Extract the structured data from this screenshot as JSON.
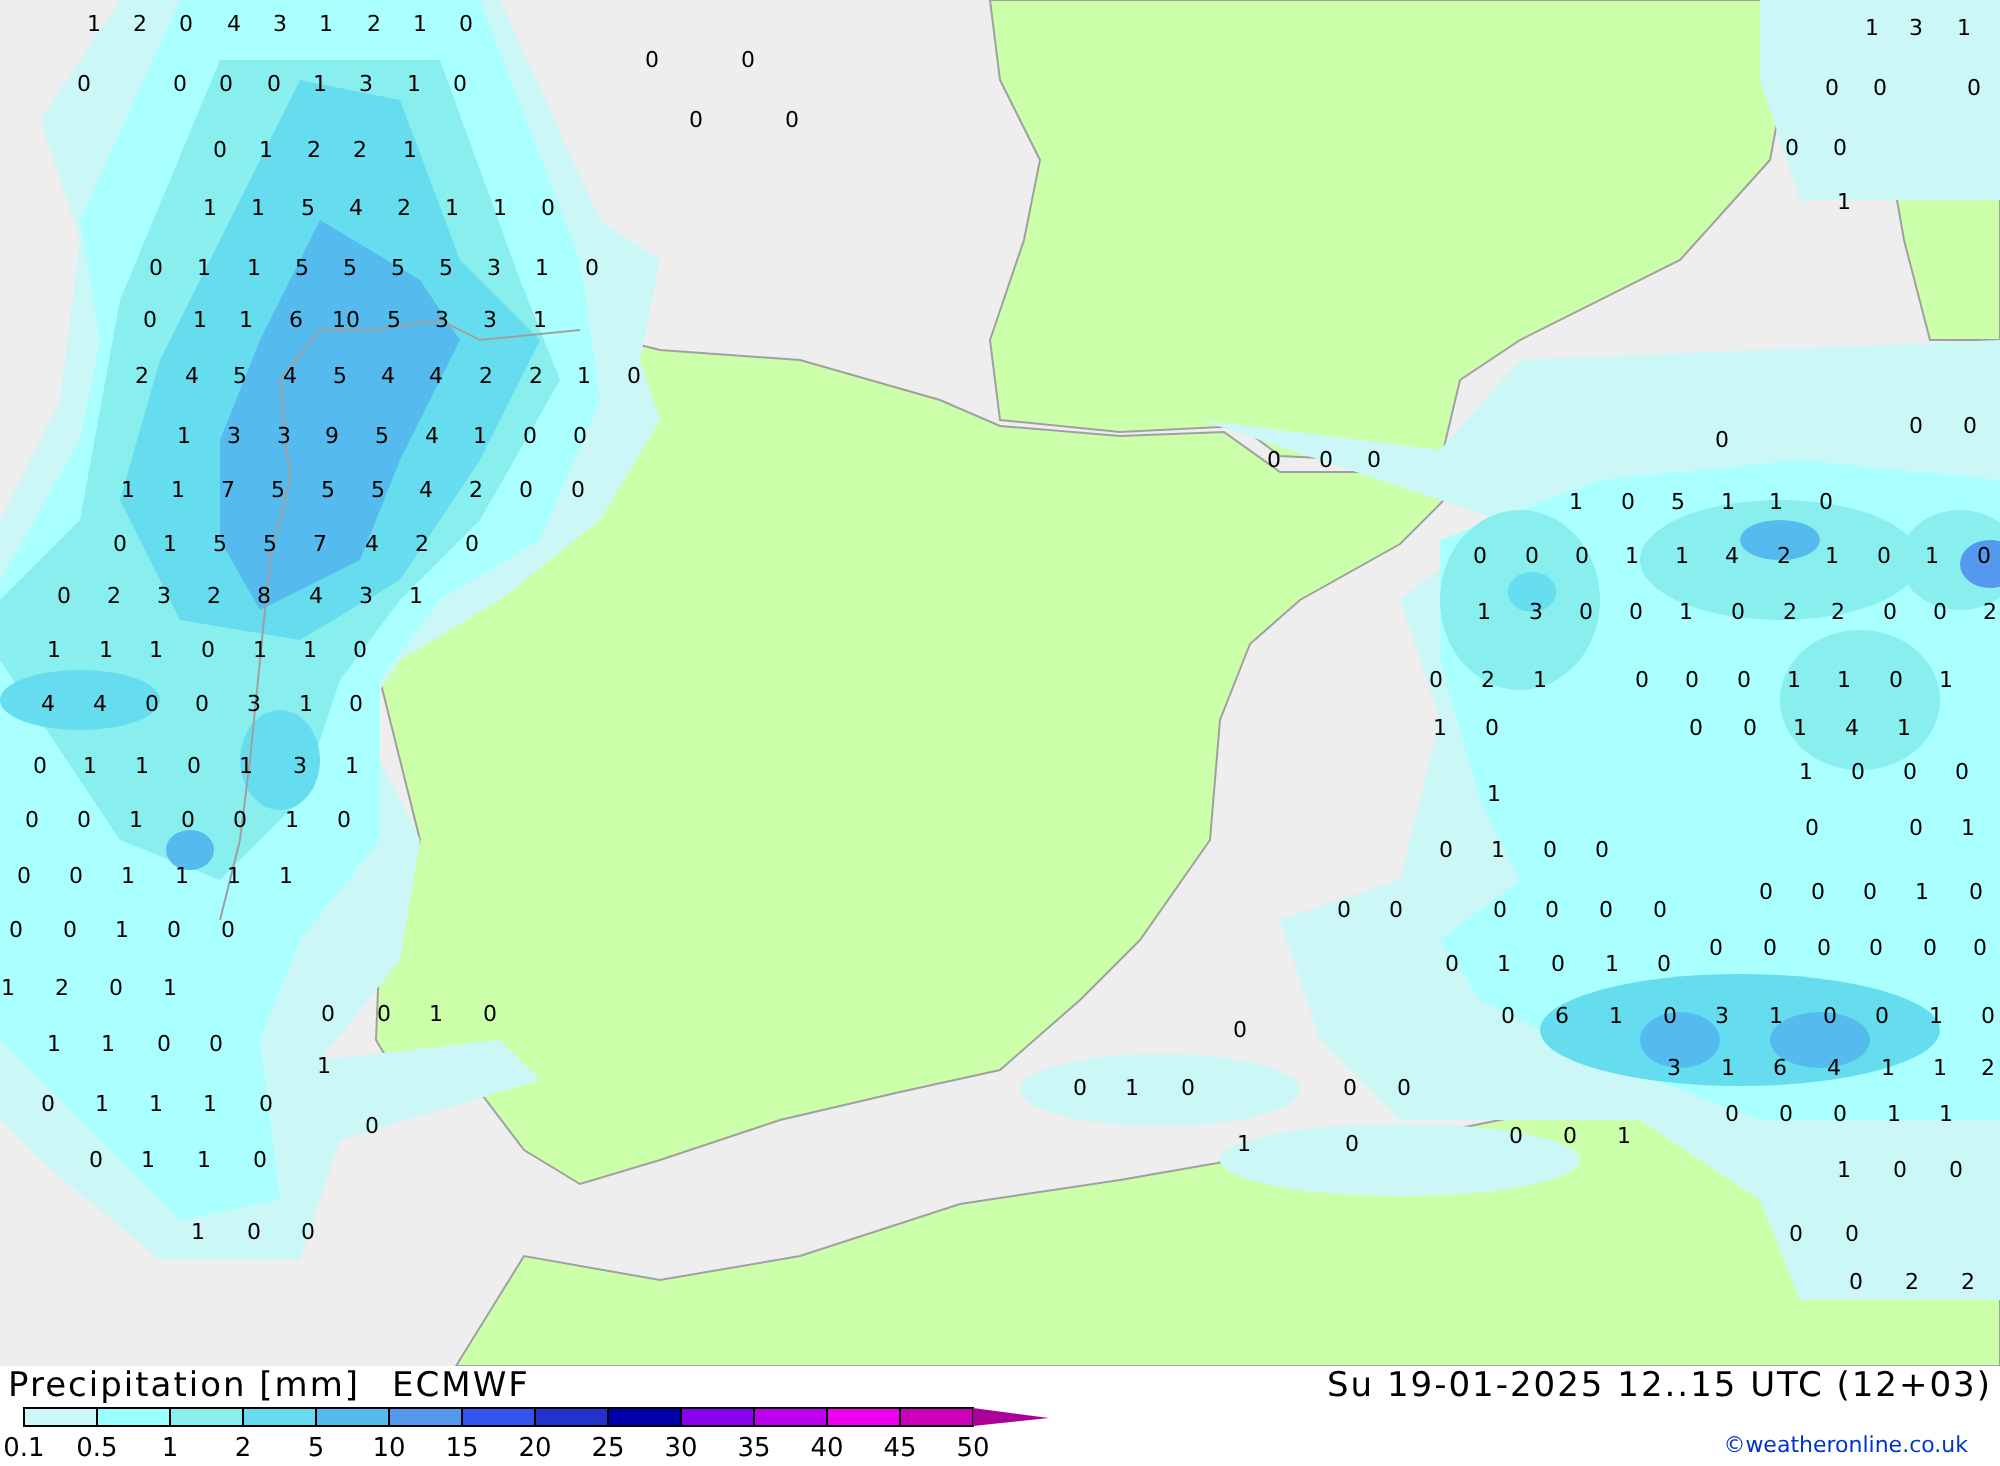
{
  "map": {
    "precip_values": [
      "1",
      "2",
      "0",
      "4",
      "3",
      "1",
      "2",
      "1",
      "0",
      "0",
      "0",
      "0",
      "0",
      "0",
      "0",
      "1",
      "3",
      "1",
      "0",
      "0",
      "0",
      "0",
      "1",
      "2",
      "2",
      "1",
      "1",
      "1",
      "5",
      "4",
      "2",
      "1",
      "1",
      "0",
      "0",
      "1",
      "1",
      "5",
      "5",
      "5",
      "5",
      "3",
      "1",
      "0",
      "0",
      "1",
      "1",
      "6",
      "10",
      "5",
      "3",
      "3",
      "1",
      "2",
      "4",
      "5",
      "4",
      "5",
      "4",
      "4",
      "2",
      "2",
      "1",
      "0",
      "1",
      "3",
      "3",
      "9",
      "5",
      "4",
      "1",
      "0",
      "0",
      "1",
      "1",
      "7",
      "5",
      "5",
      "5",
      "4",
      "2",
      "0",
      "0",
      "0",
      "1",
      "5",
      "5",
      "7",
      "4",
      "2",
      "0",
      "0",
      "2",
      "3",
      "2",
      "8",
      "4",
      "3",
      "1",
      "1",
      "1",
      "1",
      "0",
      "1",
      "1",
      "0",
      "4",
      "4",
      "0",
      "0",
      "3",
      "1",
      "0",
      "0",
      "1",
      "1",
      "0",
      "1",
      "3",
      "1",
      "0",
      "0",
      "1",
      "0",
      "0",
      "1",
      "0",
      "0",
      "0",
      "1",
      "1",
      "1",
      "1",
      "0",
      "0",
      "1",
      "0",
      "0",
      "1",
      "2",
      "0",
      "1",
      "0",
      "0",
      "1",
      "0",
      "1",
      "1",
      "0",
      "0",
      "1",
      "0",
      "1",
      "1",
      "1",
      "0",
      "0",
      "0",
      "1",
      "1",
      "0",
      "1",
      "0",
      "0",
      "1",
      "3",
      "1",
      "0",
      "0",
      "0",
      "0",
      "0",
      "1",
      "0",
      "0",
      "0",
      "0",
      "0",
      "0",
      "1",
      "0",
      "5",
      "1",
      "1",
      "0",
      "0",
      "0",
      "0",
      "1",
      "1",
      "4",
      "2",
      "1",
      "0",
      "1",
      "0",
      "1",
      "3",
      "0",
      "0",
      "1",
      "0",
      "2",
      "2",
      "0",
      "0",
      "2",
      "0",
      "2",
      "1",
      "0",
      "0",
      "0",
      "1",
      "1",
      "0",
      "1",
      "1",
      "0",
      "0",
      "0",
      "1",
      "4",
      "1",
      "1",
      "0",
      "0",
      "0",
      "1",
      "0",
      "0",
      "1",
      "0",
      "1",
      "0",
      "0",
      "0",
      "0",
      "0",
      "1",
      "0",
      "0",
      "0",
      "0",
      "0",
      "0",
      "0",
      "0",
      "1",
      "0",
      "1",
      "0",
      "0",
      "0",
      "0",
      "0",
      "0",
      "0",
      "0",
      "6",
      "1",
      "0",
      "3",
      "1",
      "0",
      "0",
      "1",
      "0",
      "3",
      "1",
      "6",
      "4",
      "1",
      "1",
      "2",
      "0",
      "0",
      "1",
      "0",
      "0",
      "0",
      "0",
      "0",
      "1",
      "0",
      "0",
      "0",
      "1",
      "1",
      "1",
      "0",
      "1",
      "0",
      "0",
      "0",
      "0",
      "0",
      "2",
      "2"
    ]
  },
  "legend": {
    "title": "Precipitation [mm]",
    "model": "ECMWF",
    "valid_time": "Su 19-01-2025 12..15 UTC (12+03)",
    "swatches": [
      {
        "color": "#ccf8f8"
      },
      {
        "color": "#99ffff"
      },
      {
        "color": "#88eeee"
      },
      {
        "color": "#66dcee"
      },
      {
        "color": "#55bbee"
      },
      {
        "color": "#5599ee"
      },
      {
        "color": "#3355ee"
      },
      {
        "color": "#2233cc"
      },
      {
        "color": "#0000aa"
      },
      {
        "color": "#8800ee"
      },
      {
        "color": "#bb00ee"
      },
      {
        "color": "#ee00ee"
      },
      {
        "color": "#cc00bb"
      }
    ],
    "arrow": {
      "color": "#aa0099"
    },
    "ticks": [
      "0.1",
      "0.5",
      "1",
      "2",
      "5",
      "10",
      "15",
      "20",
      "25",
      "30",
      "35",
      "40",
      "45",
      "50"
    ],
    "credit": "©weatheronline.co.uk"
  }
}
